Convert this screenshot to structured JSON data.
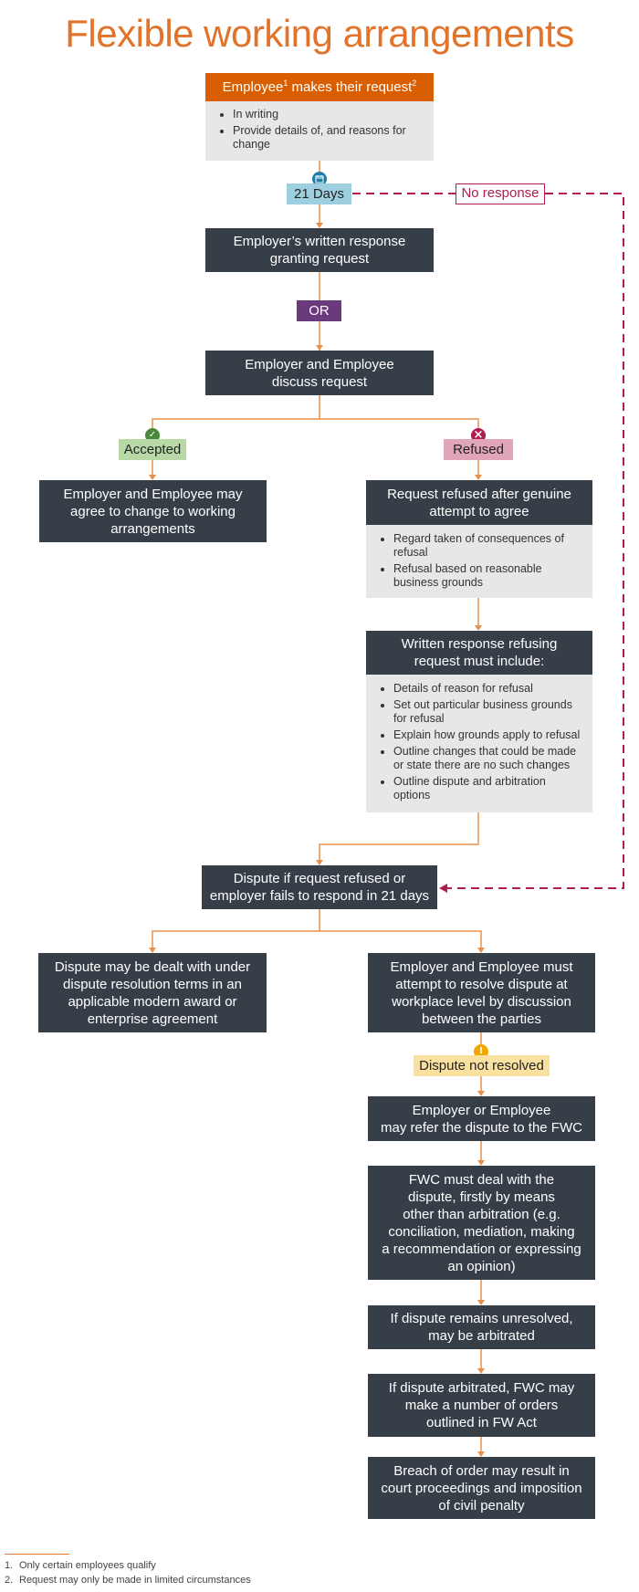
{
  "title": "Flexible working arrangements",
  "colors": {
    "accent_orange": "#d95e00",
    "title_orange": "#e2732a",
    "connector": "#e8904a",
    "dark_box": "#363f48",
    "grey_box": "#e7e7e7",
    "days_badge": "#9ecfde",
    "no_response": "#b01e4f",
    "or_badge": "#6b3a7d",
    "accepted_badge": "#b8d8a6",
    "accepted_icon": "#4a8a3a",
    "refused_badge": "#e0a5bb",
    "refused_icon": "#b01e4f",
    "not_resolved_badge": "#fbe1a0",
    "warning_icon": "#f0a800",
    "calendar_icon": "#1f7fa6"
  },
  "start": {
    "header_prefix": "Employee",
    "header_sup1": "1",
    "header_middle": " makes their request",
    "header_sup2": "2",
    "bullets": [
      "In writing",
      "Provide details of, and reasons for change"
    ]
  },
  "days_badge": {
    "label": "21 Days",
    "icon": "calendar-icon"
  },
  "no_response": {
    "label": "No response"
  },
  "granting": {
    "line1": "Employer’s written response",
    "line2": "granting request"
  },
  "or_label": "OR",
  "discuss": {
    "line1": "Employer and Employee",
    "line2": "discuss request"
  },
  "accepted": {
    "label": "Accepted",
    "icon": "check-icon",
    "glyph": "✓"
  },
  "refused": {
    "label": "Refused",
    "icon": "cross-icon",
    "glyph": "×"
  },
  "accepted_box": {
    "line1": "Employer and Employee may",
    "line2": "agree to change to working",
    "line3": "arrangements"
  },
  "refused_box": {
    "line1": "Request refused after genuine",
    "line2": "attempt to agree",
    "bullets": [
      "Regard taken of consequences of refusal",
      "Refusal based on reasonable business grounds"
    ]
  },
  "written_refusal": {
    "line1": "Written response refusing",
    "line2": "request must include:",
    "bullets": [
      "Details of reason for refusal",
      "Set out particular business grounds for refusal",
      "Explain how grounds apply to refusal",
      "Outline changes that could be made or state there are no such changes",
      "Outline dispute and arbitration options"
    ]
  },
  "dispute": {
    "line1": "Dispute if request refused or",
    "line2": "employer fails to respond in 21 days"
  },
  "dispute_left": {
    "line1": "Dispute may be dealt with under",
    "line2": "dispute resolution terms in an",
    "line3": "applicable modern award or",
    "line4": "enterprise agreement"
  },
  "dispute_right": {
    "line1": "Employer and Employee must",
    "line2": "attempt to resolve dispute at",
    "line3": "workplace level by discussion",
    "line4": "between the parties"
  },
  "not_resolved": {
    "label": "Dispute not resolved",
    "icon": "warning-icon",
    "glyph": "!"
  },
  "refer": {
    "line1": "Employer or Employee",
    "line2": "may refer the dispute to the FWC"
  },
  "fwc": {
    "line1": "FWC must deal with the",
    "line2": "dispute, firstly by means",
    "line3": "other than arbitration (e.g.",
    "line4": "conciliation, mediation, making",
    "line5": "a recommendation or expressing",
    "line6": "an opinion)"
  },
  "unresolved": {
    "line1": "If dispute remains unresolved,",
    "line2": "may be arbitrated"
  },
  "arbitrated": {
    "line1": "If dispute arbitrated, FWC may",
    "line2": "make a number of orders",
    "line3": "outlined in FW Act"
  },
  "breach": {
    "line1": "Breach of order may result in",
    "line2": "court proceedings and imposition",
    "line3": "of civil penalty"
  },
  "footnotes": [
    {
      "num": "1.",
      "text": "Only certain employees qualify"
    },
    {
      "num": "2.",
      "text": "Request may only be made in limited circumstances"
    }
  ]
}
